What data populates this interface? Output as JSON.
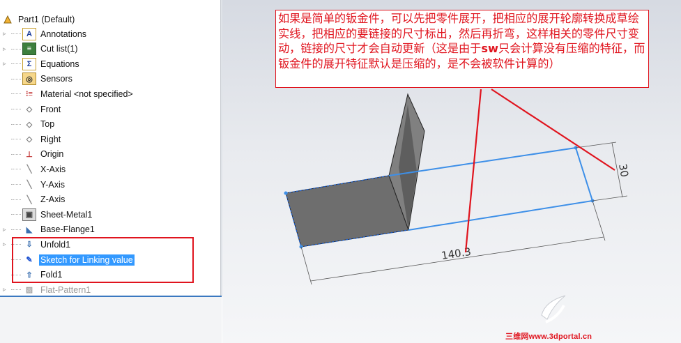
{
  "feature_tree": {
    "root": "Part1  (Default)",
    "items": [
      {
        "label": "Annotations",
        "icon": "annotations-icon"
      },
      {
        "label": "Cut list(1)",
        "icon": "cut-list-icon"
      },
      {
        "label": "Equations",
        "icon": "equations-icon"
      },
      {
        "label": "Sensors",
        "icon": "sensors-icon"
      },
      {
        "label": "Material <not specified>",
        "icon": "material-icon"
      },
      {
        "label": "Front",
        "icon": "plane-icon"
      },
      {
        "label": "Top",
        "icon": "plane-icon"
      },
      {
        "label": "Right",
        "icon": "plane-icon"
      },
      {
        "label": "Origin",
        "icon": "origin-icon"
      },
      {
        "label": "X-Axis",
        "icon": "axis-icon"
      },
      {
        "label": "Y-Axis",
        "icon": "axis-icon"
      },
      {
        "label": "Z-Axis",
        "icon": "axis-icon"
      },
      {
        "label": "Sheet-Metal1",
        "icon": "sheet-metal-icon"
      },
      {
        "label": "Base-Flange1",
        "icon": "base-flange-icon"
      },
      {
        "label": "Unfold1",
        "icon": "unfold-icon"
      },
      {
        "label": "Sketch for Linking value",
        "icon": "sketch-icon",
        "selected": true
      },
      {
        "label": "Fold1",
        "icon": "fold-icon"
      },
      {
        "label": "Flat-Pattern1",
        "icon": "flat-pattern-icon",
        "suppressed": true
      }
    ]
  },
  "annotation": {
    "text_a": "如果是简单的钣金件，可以先把零件展开，把相应的展开轮廓转换成草绘实线，把相应的要链接的尺寸标出，然后再折弯，这样相关的零件尺寸变动，链接的尺寸才会自动更新（这是由于",
    "text_b": "sw",
    "text_c": "只会计算没有压缩的特征，而钣金件的展开特征默认是压缩的，是不会被软件计算的）"
  },
  "dimensions": {
    "length": "140.3",
    "width": "30"
  },
  "watermark": "三维网www.3dportal.cn",
  "colors": {
    "annotation_red": "#e0141e",
    "selection_blue": "#3399ff",
    "sketch_blue": "#3d8fe8",
    "part_gray": "#6e6e6e"
  }
}
